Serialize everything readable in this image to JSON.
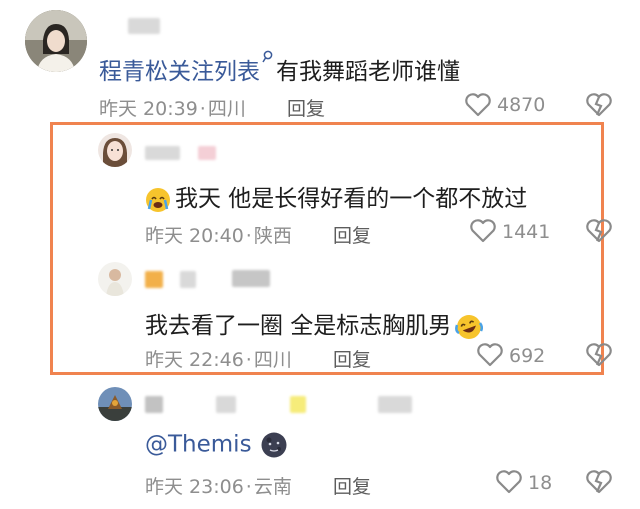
{
  "comments": [
    {
      "mention": "程青松关注列表",
      "text": "有我舞蹈老师谁懂",
      "time": "昨天 20:39",
      "location": "四川",
      "reply_label": "回复",
      "likes": "4870"
    },
    {
      "text": "我天 他是长得好看的一个都不放过",
      "time": "昨天 20:40",
      "location": "陕西",
      "reply_label": "回复",
      "likes": "1441"
    },
    {
      "text": "我去看了一圈  全是标志胸肌男",
      "time": "昨天 22:46",
      "location": "四川",
      "reply_label": "回复",
      "likes": "692"
    },
    {
      "text": "@Themis",
      "time": "昨天 23:06",
      "location": "云南",
      "reply_label": "回复",
      "likes": "18"
    }
  ],
  "colors": {
    "mention": "#3a5a99",
    "highlight_border": "#f0834f",
    "meta_gray": "#8e8e8e"
  }
}
